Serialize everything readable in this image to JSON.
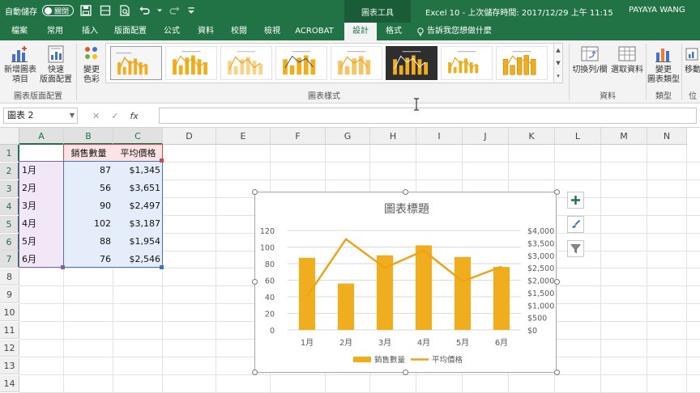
{
  "titlebar": {
    "autosave_label": "自動儲存",
    "autosave_state": "關閉",
    "context_tab": "圖表工具",
    "document_title": "Excel 10 - 上次儲存時間: 2017/12/29 上午 11:15",
    "user_name": "PAYAYA WANG"
  },
  "tabs": [
    {
      "label": "檔案"
    },
    {
      "label": "常用"
    },
    {
      "label": "插入"
    },
    {
      "label": "版面配置"
    },
    {
      "label": "公式"
    },
    {
      "label": "資料"
    },
    {
      "label": "校閱"
    },
    {
      "label": "檢視"
    },
    {
      "label": "ACROBAT"
    },
    {
      "label": "設計"
    },
    {
      "label": "格式"
    }
  ],
  "active_tab": "設計",
  "tell_me": "告訴我您想做什麼",
  "ribbon": {
    "add_element_label_1": "新增圖表",
    "add_element_label_2": "項目",
    "quick_layout_label_1": "快速",
    "quick_layout_label_2": "版面配置",
    "change_colors_label_1": "變更",
    "change_colors_label_2": "色彩",
    "layout_group": "圖表版面配置",
    "styles_group": "圖表樣式",
    "switch_row_col": "切換列/欄",
    "select_data": "選取資料",
    "data_group": "資料",
    "change_type_label_1": "變更",
    "change_type_label_2": "圖表類型",
    "type_group": "類型",
    "move_chart_label": "移動",
    "location_group": "位"
  },
  "formula_bar": {
    "name_box": "圖表 2",
    "cancel": "✕",
    "enter": "✓",
    "fx": "fx",
    "formula": ""
  },
  "columns": [
    "A",
    "B",
    "C",
    "D",
    "E",
    "F",
    "G",
    "H",
    "I",
    "J",
    "K",
    "L",
    "M",
    "N"
  ],
  "rows": [
    "1",
    "2",
    "3",
    "4",
    "5",
    "6",
    "7",
    "8",
    "9",
    "10",
    "11",
    "12",
    "13",
    "14"
  ],
  "sheet": {
    "headers": [
      "銷售數量",
      "平均價格"
    ],
    "data": [
      {
        "month": "1月",
        "qty": "87",
        "price": "$1,345"
      },
      {
        "month": "2月",
        "qty": "56",
        "price": "$3,651"
      },
      {
        "month": "3月",
        "qty": "90",
        "price": "$2,497"
      },
      {
        "month": "4月",
        "qty": "102",
        "price": "$3,187"
      },
      {
        "month": "5月",
        "qty": "88",
        "price": "$1,954"
      },
      {
        "month": "6月",
        "qty": "76",
        "price": "$2,546"
      }
    ]
  },
  "chart_data": {
    "type": "bar",
    "title": "圖表標題",
    "categories": [
      "1月",
      "2月",
      "3月",
      "4月",
      "5月",
      "6月"
    ],
    "series": [
      {
        "name": "銷售數量",
        "type": "bar",
        "axis": "left",
        "values": [
          87,
          56,
          90,
          102,
          88,
          76
        ],
        "color": "#f0ad1e"
      },
      {
        "name": "平均價格",
        "type": "line",
        "axis": "right",
        "values": [
          1345,
          3651,
          2497,
          3187,
          1954,
          2546
        ],
        "color": "#f0a118"
      }
    ],
    "y_left": {
      "min": 0,
      "max": 120,
      "ticks": [
        "0",
        "20",
        "40",
        "60",
        "80",
        "100",
        "120"
      ]
    },
    "y_right": {
      "min": 0,
      "max": 4000,
      "ticks": [
        "$0",
        "$500",
        "$1,000",
        "$1,500",
        "$2,000",
        "$2,500",
        "$3,000",
        "$3,500",
        "$4,000"
      ]
    },
    "grid": true,
    "legend": "bottom"
  },
  "colors": {
    "excel_green": "#217346",
    "bar": "#f0ad1e",
    "line": "#f0a118"
  }
}
